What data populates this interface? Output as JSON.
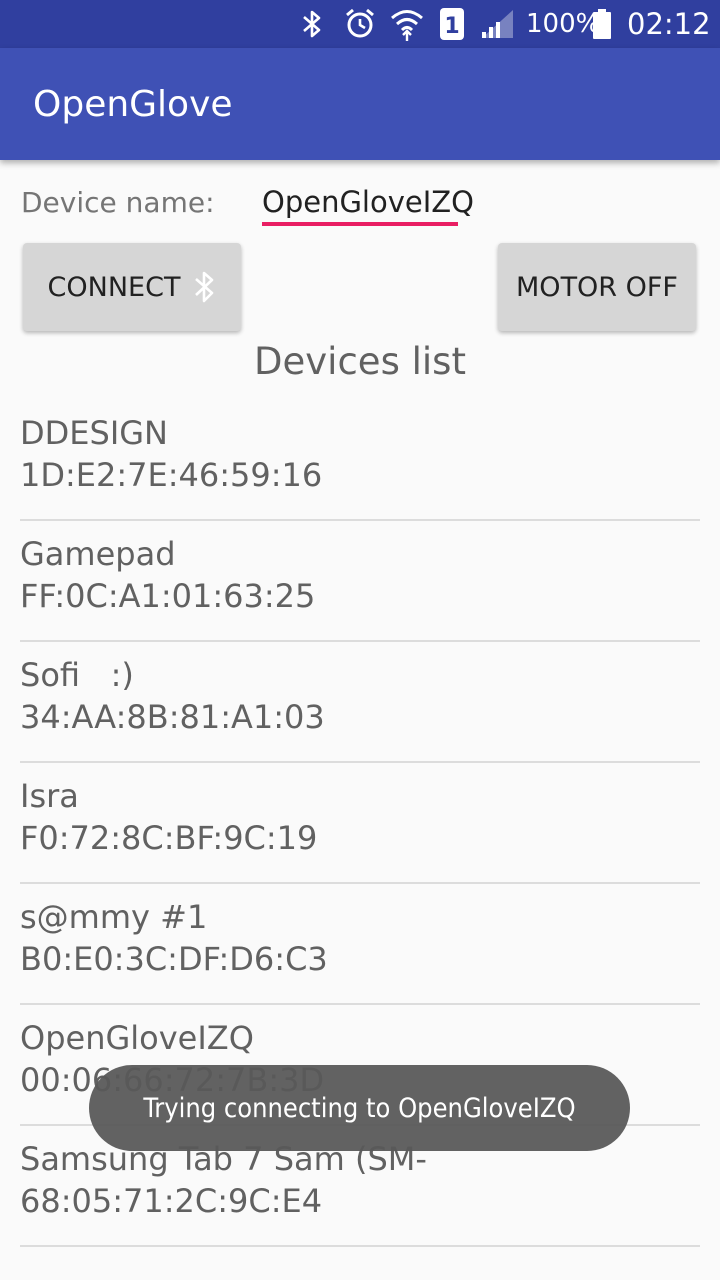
{
  "status_bar": {
    "icons": [
      "bluetooth-icon",
      "alarm-icon",
      "wifi-icon",
      "sim-icon",
      "signal-icon",
      "battery-icon"
    ],
    "sim_label": "1",
    "battery": "100%",
    "time": "02:12"
  },
  "app_bar": {
    "title": "OpenGlove"
  },
  "form": {
    "device_name_label": "Device name:",
    "device_name_value": "OpenGloveIZQ",
    "accent_color": "#e91e63"
  },
  "buttons": {
    "connect_label": "CONNECT",
    "connect_icon": "bluetooth-icon",
    "motor_label": "MOTOR OFF"
  },
  "devices_list": {
    "title": "Devices list",
    "items": [
      {
        "name": "DDESIGN",
        "address": "1D:E2:7E:46:59:16"
      },
      {
        "name": "Gamepad",
        "address": "FF:0C:A1:01:63:25"
      },
      {
        "name": "Sofi   :)",
        "address": "34:AA:8B:81:A1:03"
      },
      {
        "name": "Isra",
        "address": "F0:72:8C:BF:9C:19"
      },
      {
        "name": "s@mmy #1",
        "address": "B0:E0:3C:DF:D6:C3"
      },
      {
        "name": "OpenGloveIZQ",
        "address": "00:06:66:72:7B:3D"
      },
      {
        "name": "Samsung Tab 7 Sam (SM-",
        "address": "68:05:71:2C:9C:E4"
      }
    ]
  },
  "toast": {
    "text": "Trying connecting to OpenGloveIZQ"
  },
  "colors": {
    "status_bar": "#303f9f",
    "app_bar": "#3f51b5",
    "background": "#fafafa",
    "button": "#d6d6d6"
  }
}
